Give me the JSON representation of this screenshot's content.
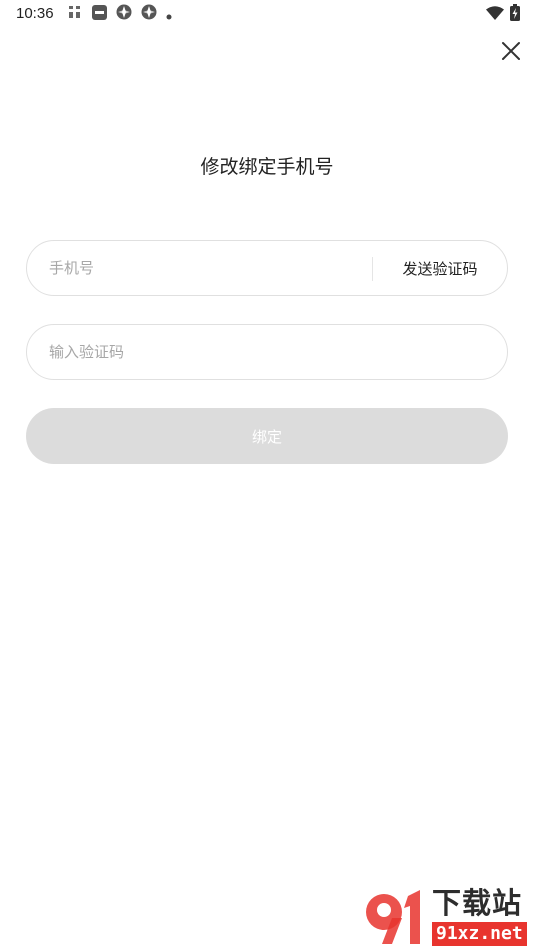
{
  "status_bar": {
    "time": "10:36",
    "left_icons": [
      "app-icon-a",
      "app-icon-b",
      "app-icon-c",
      "app-icon-d",
      "dot-icon"
    ],
    "right_icons": [
      "wifi-icon",
      "battery-charging-icon"
    ]
  },
  "header": {
    "close_icon": "close-icon"
  },
  "form": {
    "title": "修改绑定手机号",
    "phone_placeholder": "手机号",
    "send_code_label": "发送验证码",
    "code_placeholder": "输入验证码",
    "bind_label": "绑定"
  },
  "colors": {
    "bind_button_disabled": "#dcdcdc",
    "field_border": "#e0e0e0",
    "placeholder": "#a7a7a7",
    "watermark_red": "#e8342e"
  },
  "watermark": {
    "logo_text": "91",
    "title": "下载站",
    "domain": "91xz.net"
  }
}
